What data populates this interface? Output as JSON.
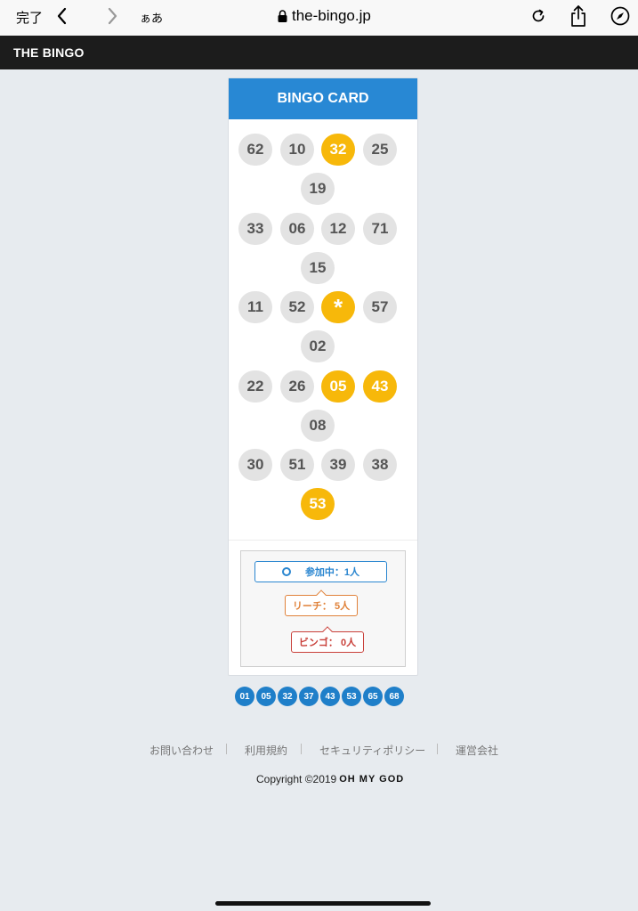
{
  "browser": {
    "done_label": "完了",
    "reader_label": "ぁあ",
    "url": "the-bingo.jp"
  },
  "site": {
    "title": "THE BINGO"
  },
  "card": {
    "title": "BINGO CARD",
    "numbers": [
      "62",
      "10",
      "32",
      "25",
      "19",
      "33",
      "06",
      "12",
      "71",
      "15",
      "11",
      "52",
      "*",
      "57",
      "02",
      "22",
      "26",
      "05",
      "43",
      "08",
      "30",
      "51",
      "39",
      "38",
      "53"
    ],
    "marked": [
      false,
      false,
      true,
      false,
      false,
      false,
      false,
      false,
      false,
      false,
      false,
      false,
      true,
      false,
      false,
      false,
      false,
      true,
      true,
      false,
      false,
      false,
      false,
      false,
      true
    ]
  },
  "status": {
    "joined": "参加中：1人",
    "reach": "リーチ： 5人",
    "bingo": "ビンゴ： 0人"
  },
  "called_numbers": [
    "01",
    "05",
    "32",
    "37",
    "43",
    "53",
    "65",
    "68"
  ],
  "footer": {
    "links": [
      "お問い合わせ",
      "利用規約",
      "セキュリティポリシー",
      "運営会社"
    ],
    "copyright": "Copyright ©2019",
    "brand": "OH MY GOD"
  },
  "colors": {
    "header_blue": "#2888d4",
    "marked_yellow": "#f7b80a",
    "called_blue": "#1f7fc9",
    "reach_orange": "#e0823a",
    "bingo_red": "#c9403a"
  }
}
